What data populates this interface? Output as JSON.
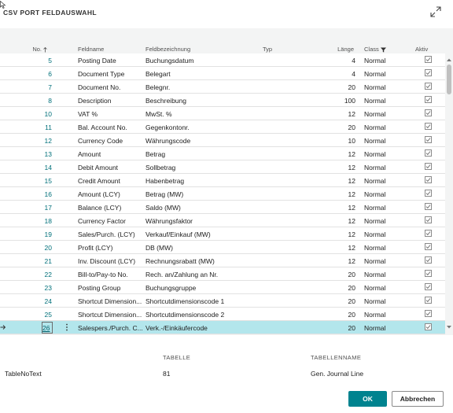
{
  "dialog": {
    "title": "CSV PORT FELDAUSWAHL"
  },
  "grid": {
    "headers": {
      "no": "No.",
      "feldname": "Feldname",
      "feldbezeichnung": "Feldbezeichnung",
      "typ": "Typ",
      "laenge": "Länge",
      "class": "Class",
      "aktiv": "Aktiv"
    },
    "rows": [
      {
        "no": "5",
        "feldname": "Posting Date",
        "feldbezeichnung": "Buchungsdatum",
        "laenge": "4",
        "class": "Normal",
        "aktiv": true
      },
      {
        "no": "6",
        "feldname": "Document Type",
        "feldbezeichnung": "Belegart",
        "laenge": "4",
        "class": "Normal",
        "aktiv": true
      },
      {
        "no": "7",
        "feldname": "Document No.",
        "feldbezeichnung": "Belegnr.",
        "laenge": "20",
        "class": "Normal",
        "aktiv": true
      },
      {
        "no": "8",
        "feldname": "Description",
        "feldbezeichnung": "Beschreibung",
        "laenge": "100",
        "class": "Normal",
        "aktiv": true
      },
      {
        "no": "10",
        "feldname": "VAT %",
        "feldbezeichnung": "MwSt. %",
        "laenge": "12",
        "class": "Normal",
        "aktiv": true
      },
      {
        "no": "11",
        "feldname": "Bal. Account No.",
        "feldbezeichnung": "Gegenkontonr.",
        "laenge": "20",
        "class": "Normal",
        "aktiv": true
      },
      {
        "no": "12",
        "feldname": "Currency Code",
        "feldbezeichnung": "Währungscode",
        "laenge": "10",
        "class": "Normal",
        "aktiv": true
      },
      {
        "no": "13",
        "feldname": "Amount",
        "feldbezeichnung": "Betrag",
        "laenge": "12",
        "class": "Normal",
        "aktiv": true
      },
      {
        "no": "14",
        "feldname": "Debit Amount",
        "feldbezeichnung": "Sollbetrag",
        "laenge": "12",
        "class": "Normal",
        "aktiv": true
      },
      {
        "no": "15",
        "feldname": "Credit Amount",
        "feldbezeichnung": "Habenbetrag",
        "laenge": "12",
        "class": "Normal",
        "aktiv": true
      },
      {
        "no": "16",
        "feldname": "Amount (LCY)",
        "feldbezeichnung": "Betrag (MW)",
        "laenge": "12",
        "class": "Normal",
        "aktiv": true
      },
      {
        "no": "17",
        "feldname": "Balance (LCY)",
        "feldbezeichnung": "Saldo (MW)",
        "laenge": "12",
        "class": "Normal",
        "aktiv": true
      },
      {
        "no": "18",
        "feldname": "Currency Factor",
        "feldbezeichnung": "Währungsfaktor",
        "laenge": "12",
        "class": "Normal",
        "aktiv": true
      },
      {
        "no": "19",
        "feldname": "Sales/Purch. (LCY)",
        "feldbezeichnung": "Verkauf/Einkauf (MW)",
        "laenge": "12",
        "class": "Normal",
        "aktiv": true
      },
      {
        "no": "20",
        "feldname": "Profit (LCY)",
        "feldbezeichnung": "DB (MW)",
        "laenge": "12",
        "class": "Normal",
        "aktiv": true
      },
      {
        "no": "21",
        "feldname": "Inv. Discount (LCY)",
        "feldbezeichnung": "Rechnungsrabatt (MW)",
        "laenge": "12",
        "class": "Normal",
        "aktiv": true
      },
      {
        "no": "22",
        "feldname": "Bill-to/Pay-to No.",
        "feldbezeichnung": "Rech. an/Zahlung an Nr.",
        "laenge": "20",
        "class": "Normal",
        "aktiv": true
      },
      {
        "no": "23",
        "feldname": "Posting Group",
        "feldbezeichnung": "Buchungsgruppe",
        "laenge": "20",
        "class": "Normal",
        "aktiv": true
      },
      {
        "no": "24",
        "feldname": "Shortcut Dimension...",
        "feldbezeichnung": "Shortcutdimensionscode 1",
        "laenge": "20",
        "class": "Normal",
        "aktiv": true
      },
      {
        "no": "25",
        "feldname": "Shortcut Dimension...",
        "feldbezeichnung": "Shortcutdimensionscode 2",
        "laenge": "20",
        "class": "Normal",
        "aktiv": true
      },
      {
        "no": "26",
        "feldname": "Salespers./Purch. C...",
        "feldbezeichnung": "Verk.-/Einkäufercode",
        "laenge": "20",
        "class": "Normal",
        "aktiv": true,
        "selected": true
      }
    ]
  },
  "footer": {
    "table_name_label": "TableNoText",
    "tabelle_label": "TABELLE",
    "tabelle_value": "81",
    "tabellenname_label": "TABELLENNAME",
    "tabellenname_value": "Gen. Journal Line"
  },
  "buttons": {
    "ok": "OK",
    "cancel": "Abbrechen"
  },
  "colors": {
    "accent": "#00838f",
    "selected_row": "#b3e6ec",
    "link": "#00707a"
  }
}
